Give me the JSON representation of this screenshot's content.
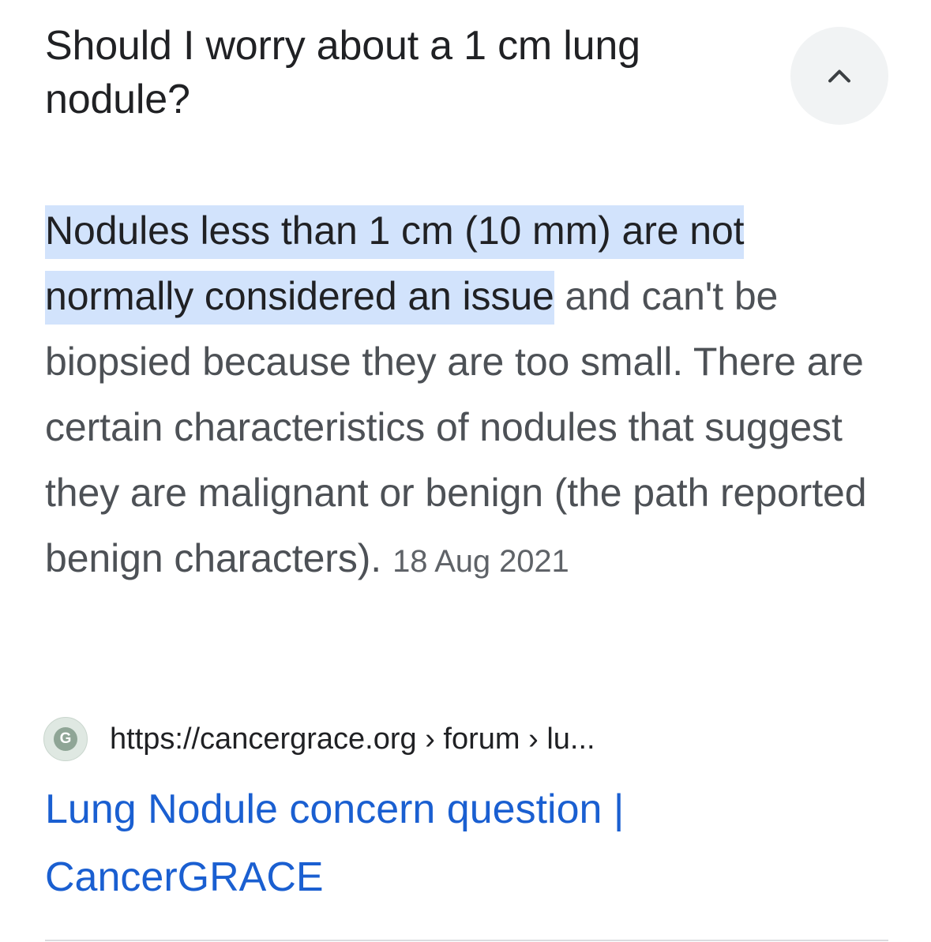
{
  "question": "Should I worry about a 1 cm lung nodule?",
  "collapse_button": {
    "icon": "chevron-up-icon",
    "expanded": true
  },
  "answer": {
    "highlighted": "Nodules less than 1 cm (10 mm) are not normally considered an issue",
    "rest": " and can't be biopsied because they are too small. There are certain characteristics of nodules that suggest they are malignant or benign (the path reported benign characters).",
    "date": "18 Aug 2021",
    "highlight_color": "#d2e3fc"
  },
  "source": {
    "favicon_letter": "G",
    "url": "https://cancergrace.org › forum › lu..."
  },
  "result_title": "Lung Nodule concern question | CancerGRACE",
  "colors": {
    "title_text": "#202124",
    "body_text": "#4d5156",
    "link": "#1a5fd1",
    "button_bg": "#f1f3f4"
  }
}
